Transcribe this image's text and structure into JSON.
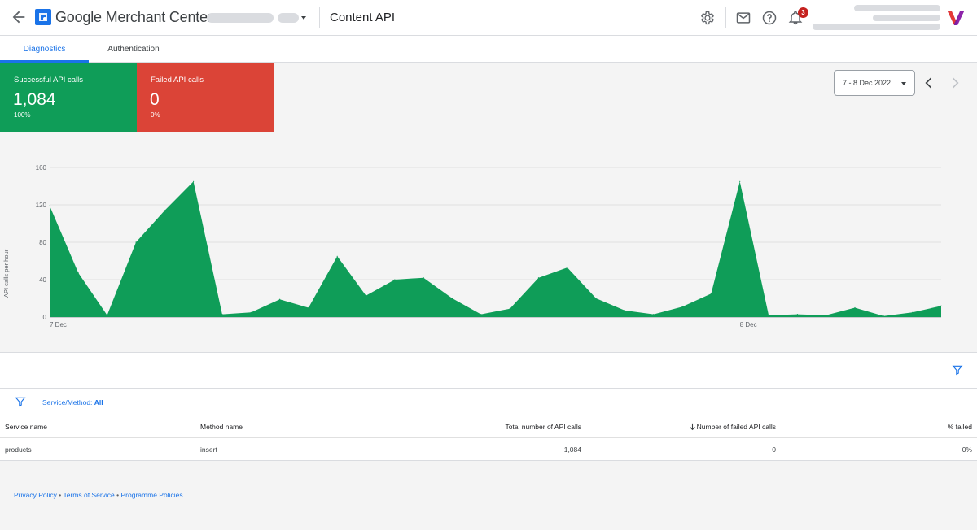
{
  "header": {
    "app_name": "Google Merchant Center",
    "page_title": "Content API",
    "notification_count": "3"
  },
  "tabs": [
    {
      "label": "Diagnostics",
      "active": true
    },
    {
      "label": "Authentication",
      "active": false
    }
  ],
  "summary": {
    "successful": {
      "label": "Successful API calls",
      "value": "1,084",
      "percent": "100%",
      "color": "#0f9d58"
    },
    "failed": {
      "label": "Failed API calls",
      "value": "0",
      "percent": "0%",
      "color": "#db4437"
    }
  },
  "date_range": {
    "label": "7 - 8 Dec 2022"
  },
  "chart_data": {
    "type": "area",
    "ylabel": "API calls per hour",
    "ylim": [
      0,
      160
    ],
    "yticks": [
      0,
      40,
      80,
      120,
      160
    ],
    "xtick_labels": [
      {
        "index": 0,
        "label": "7 Dec"
      },
      {
        "index": 24,
        "label": "8 Dec"
      }
    ],
    "series": [
      {
        "color": "#0f9d58",
        "values": [
          119,
          47,
          2,
          80,
          114,
          145,
          3,
          5,
          19,
          10,
          65,
          23,
          40,
          42,
          20,
          3,
          9,
          42,
          53,
          20,
          7,
          3,
          11,
          25,
          145,
          2,
          3,
          2,
          10,
          1,
          5,
          12
        ]
      }
    ]
  },
  "filter": {
    "label": "Service/Method:",
    "value": "All"
  },
  "table": {
    "columns": [
      "Service name",
      "Method name",
      "Total number of API calls",
      "Number of failed API calls",
      "% failed"
    ],
    "rows": [
      [
        "products",
        "insert",
        "1,084",
        "0",
        "0%"
      ]
    ]
  },
  "footer": {
    "links": [
      "Privacy Policy",
      "Terms of Service",
      "Programme Policies"
    ],
    "separator": "•"
  }
}
